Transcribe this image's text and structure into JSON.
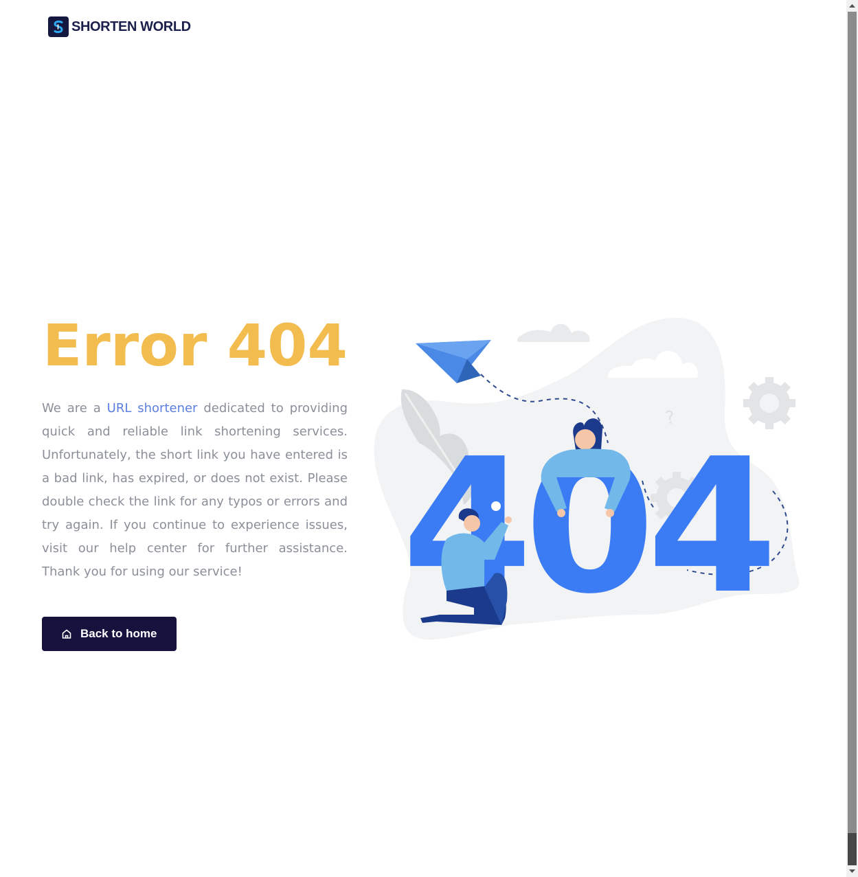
{
  "header": {
    "logo_text": "SHORTEN WORLD",
    "logo_icon": "shorten-world-logo-icon"
  },
  "main": {
    "title": "Error 404",
    "description": {
      "before_link": "We are a ",
      "link_text": "URL shortener",
      "after_link": " dedicated to providing quick and reliable link shortening services. Unfortunately, the short link you have entered is a bad link, has expired, or does not exist. Please double check the link for any typos or errors and try again. If you continue to experience issues, visit our help center for further assistance. Thank you for using our service!"
    },
    "back_button": {
      "label": "Back to home",
      "icon": "home-icon"
    }
  },
  "illustration": {
    "big_text": "404",
    "question_mark": "?"
  },
  "colors": {
    "title": "#f3bc4f",
    "link": "#5b7fe0",
    "button_bg": "#16123d",
    "illustration_blue": "#3b7cf5",
    "body_text": "#8a8f98"
  }
}
